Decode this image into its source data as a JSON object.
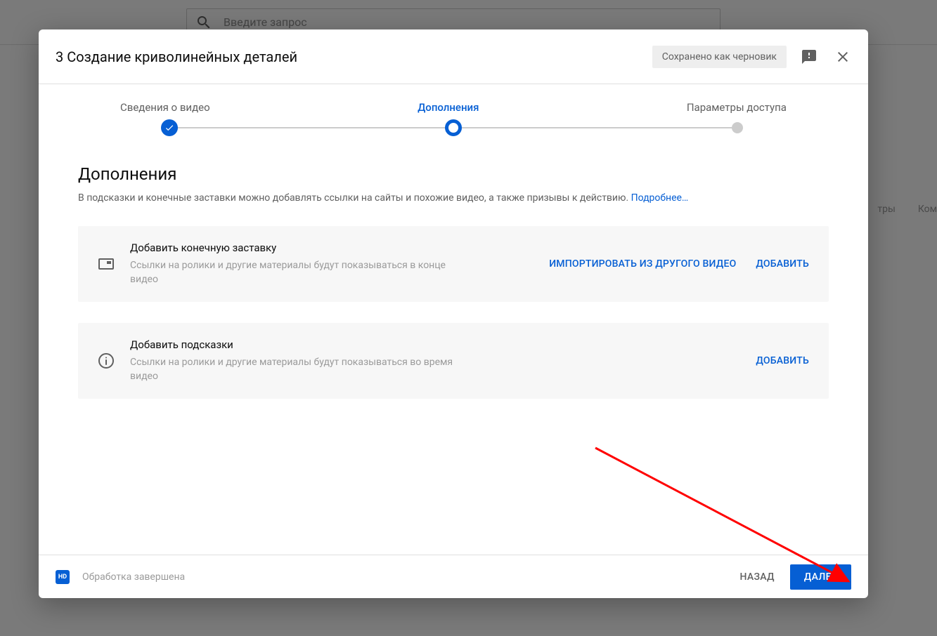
{
  "background": {
    "search_placeholder": "Введите запрос",
    "tabs": {
      "t1": "тры",
      "t2": "Ком"
    }
  },
  "dialog": {
    "title": "3 Создание криволинейных деталей",
    "saved_badge": "Сохранено как черновик"
  },
  "stepper": {
    "step1": "Сведения о видео",
    "step2": "Дополнения",
    "step3": "Параметры доступа"
  },
  "section": {
    "title": "Дополнения",
    "description": "В подсказки и конечные заставки можно добавлять ссылки на сайты и похожие видео, а также призывы к действию. ",
    "more_link": "Подробнее…"
  },
  "card_endscreen": {
    "title": "Добавить конечную заставку",
    "subtitle": "Ссылки на ролики и другие материалы будут показываться в конце видео",
    "action_import": "ИМПОРТИРОВАТЬ ИЗ ДРУГОГО ВИДЕО",
    "action_add": "ДОБАВИТЬ"
  },
  "card_cards": {
    "title": "Добавить подсказки",
    "subtitle": "Ссылки на ролики и другие материалы будут показываться во время видео",
    "action_add": "ДОБАВИТЬ"
  },
  "footer": {
    "hd": "HD",
    "status": "Обработка завершена",
    "back": "НАЗАД",
    "next": "ДАЛЕЕ"
  }
}
